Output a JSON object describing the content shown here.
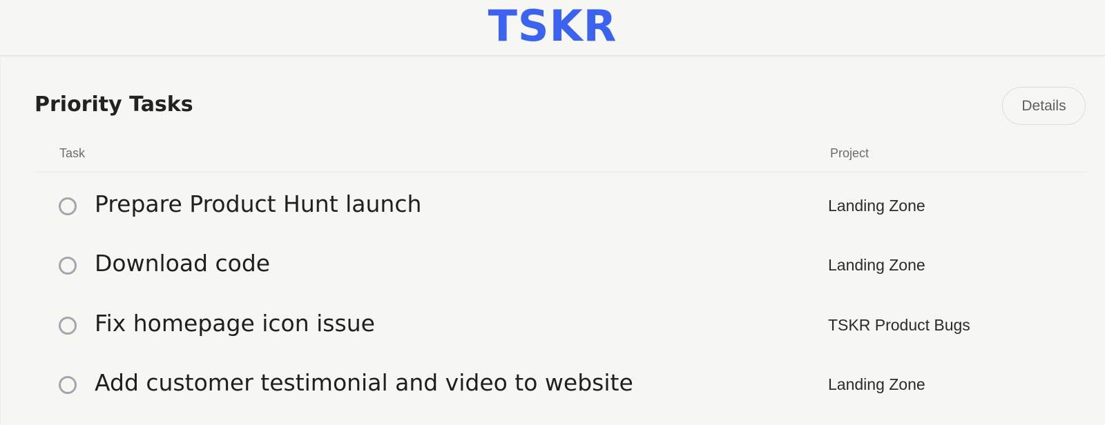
{
  "app": {
    "logo_text": "TSKR",
    "logo_color": "#3b63f0"
  },
  "panel": {
    "title": "Priority Tasks",
    "details_label": "Details"
  },
  "table": {
    "columns": [
      "Task",
      "Project"
    ],
    "rows": [
      {
        "task": "Prepare Product Hunt launch",
        "project": "Landing Zone",
        "completed": false
      },
      {
        "task": "Download code",
        "project": "Landing Zone",
        "completed": false
      },
      {
        "task": "Fix homepage icon issue",
        "project": "TSKR Product Bugs",
        "completed": false
      },
      {
        "task": "Add customer testimonial and video to website",
        "project": "Landing Zone",
        "completed": false
      }
    ]
  },
  "icons": {
    "checkbox": "circle-outline-icon"
  }
}
